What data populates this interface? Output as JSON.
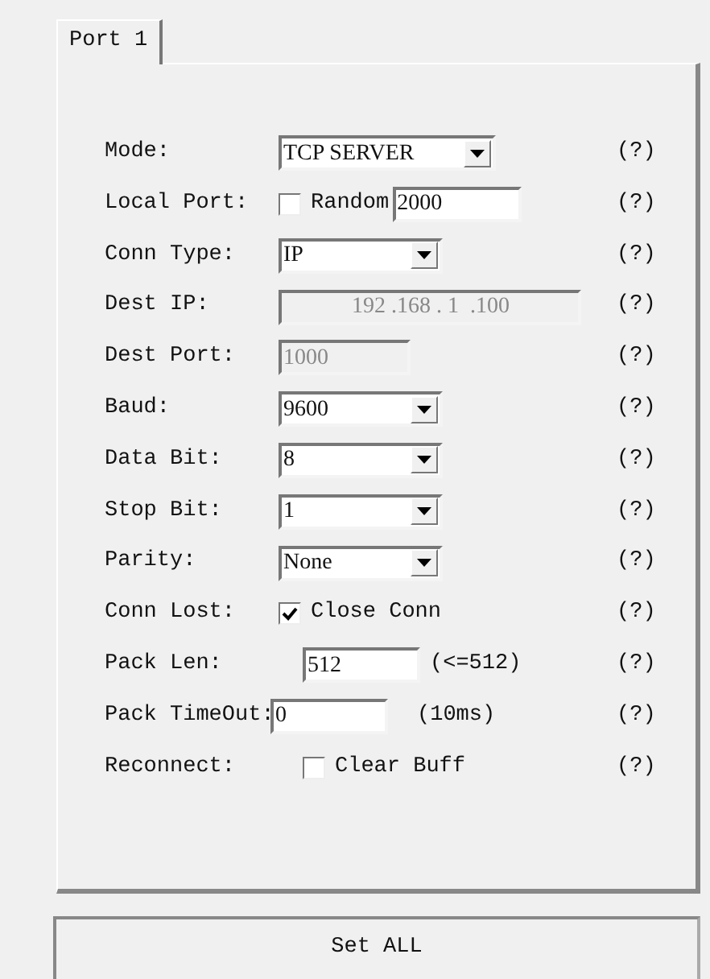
{
  "tabs": [
    {
      "label": "Port 1",
      "selected": true
    }
  ],
  "rows": [
    {
      "kind": "select",
      "label": "Mode:",
      "value": "TCP SERVER",
      "disabled": false,
      "help": "(?)"
    },
    {
      "kind": "check-input",
      "label": "Local Port:",
      "check_label": "Random",
      "checked": false,
      "value": "2000",
      "disabled": false,
      "help": "(?)"
    },
    {
      "kind": "select",
      "label": "Conn Type:",
      "value": "IP",
      "disabled": false,
      "help": "(?)"
    },
    {
      "kind": "ip",
      "label": "Dest IP:",
      "value": "192 .168 . 1  .100",
      "disabled": true,
      "help": "(?)"
    },
    {
      "kind": "input",
      "label": "Dest Port:",
      "value": "1000",
      "disabled": true,
      "help": "(?)"
    },
    {
      "kind": "select",
      "label": "Baud:",
      "value": "9600",
      "disabled": false,
      "help": "(?)"
    },
    {
      "kind": "select",
      "label": "Data Bit:",
      "value": "8",
      "disabled": false,
      "help": "(?)"
    },
    {
      "kind": "select",
      "label": "Stop Bit:",
      "value": "1",
      "disabled": false,
      "help": "(?)"
    },
    {
      "kind": "select",
      "label": "Parity:",
      "value": "None",
      "disabled": false,
      "help": "(?)"
    },
    {
      "kind": "check",
      "label": "Conn Lost:",
      "check_label": "Close Conn",
      "checked": true,
      "help": "(?)"
    },
    {
      "kind": "input-note",
      "label": "Pack Len:",
      "value": "512",
      "note": "(<=512)",
      "disabled": false,
      "help": "(?)"
    },
    {
      "kind": "input-note",
      "label": "Pack TimeOut:",
      "value": "0",
      "note": "(10ms)",
      "disabled": false,
      "help": "(?)"
    },
    {
      "kind": "check",
      "label": "Reconnect:",
      "check_label": "Clear Buff",
      "checked": false,
      "help": "(?)"
    }
  ],
  "button": "Set ALL"
}
